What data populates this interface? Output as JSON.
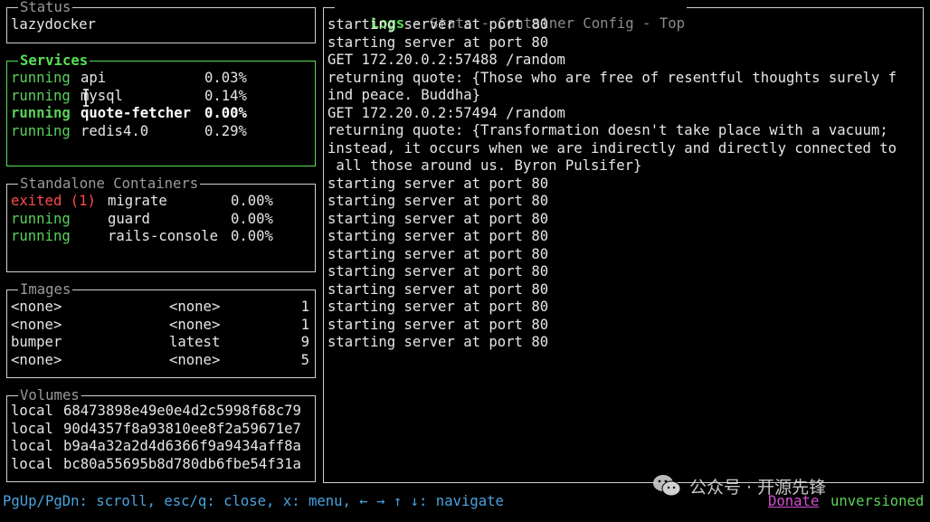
{
  "colors": {
    "active_border": "#55e055",
    "running": "#5ad15a",
    "exited": "#ff4a4a",
    "statusbar": "#4aa3e0",
    "donate": "#d44fd4"
  },
  "status": {
    "title": "Status",
    "app_name": "lazydocker"
  },
  "services": {
    "title": "Services",
    "rows": [
      {
        "state": "running",
        "name": "api",
        "cpu": "0.03%"
      },
      {
        "state": "running",
        "name": "mysql",
        "cpu": "0.14%"
      },
      {
        "state": "running",
        "name": "quote-fetcher",
        "cpu": "0.00%"
      },
      {
        "state": "running",
        "name": "redis4.0",
        "cpu": "0.29%"
      }
    ]
  },
  "standalone": {
    "title": "Standalone Containers",
    "rows": [
      {
        "state": "exited (1)",
        "name": "migrate",
        "cpu": "0.00%"
      },
      {
        "state": "running",
        "name": "guard",
        "cpu": "0.00%"
      },
      {
        "state": "running",
        "name": "rails-console",
        "cpu": "0.00%"
      }
    ]
  },
  "images": {
    "title": "Images",
    "rows": [
      {
        "name": "<none>",
        "tag": "<none>",
        "size": "1"
      },
      {
        "name": "<none>",
        "tag": "<none>",
        "size": "1"
      },
      {
        "name": "bumper",
        "tag": "latest",
        "size": "9"
      },
      {
        "name": "<none>",
        "tag": "<none>",
        "size": "5"
      }
    ]
  },
  "volumes": {
    "title": "Volumes",
    "rows": [
      {
        "driver": "local",
        "name": "68473898e49e0e4d2c5998f68c79"
      },
      {
        "driver": "local",
        "name": "90d4357f8a93810ee8f2a59671e7"
      },
      {
        "driver": "local",
        "name": "b9a4a32a2d4d6366f9a9434aff8a"
      },
      {
        "driver": "local",
        "name": "bc80a55695b8d780db6fbe54f31a"
      }
    ]
  },
  "main": {
    "tabs": [
      "Logs",
      "Stats",
      "Container Config",
      "Top"
    ],
    "separator": " - ",
    "log_lines": [
      "starting server at port 80",
      "starting server at port 80",
      "GET 172.20.0.2:57488 /random",
      "returning quote: {Those who are free of resentful thoughts surely f",
      "ind peace. Buddha}",
      "GET 172.20.0.2:57494 /random",
      "returning quote: {Transformation doesn't take place with a vacuum;",
      "instead, it occurs when we are indirectly and directly connected to",
      " all those around us. Byron Pulsifer}",
      "starting server at port 80",
      "starting server at port 80",
      "starting server at port 80",
      "starting server at port 80",
      "starting server at port 80",
      "starting server at port 80",
      "starting server at port 80",
      "starting server at port 80",
      "starting server at port 80",
      "starting server at port 80"
    ]
  },
  "footer": {
    "keybindings": "PgUp/PgDn: scroll, esc/q: close, x: menu, ← → ↑ ↓: navigate",
    "donate": "Donate",
    "version": "unversioned"
  },
  "watermark": {
    "icon": "wechat-icon",
    "text": "公众号 · 开源先锋"
  }
}
